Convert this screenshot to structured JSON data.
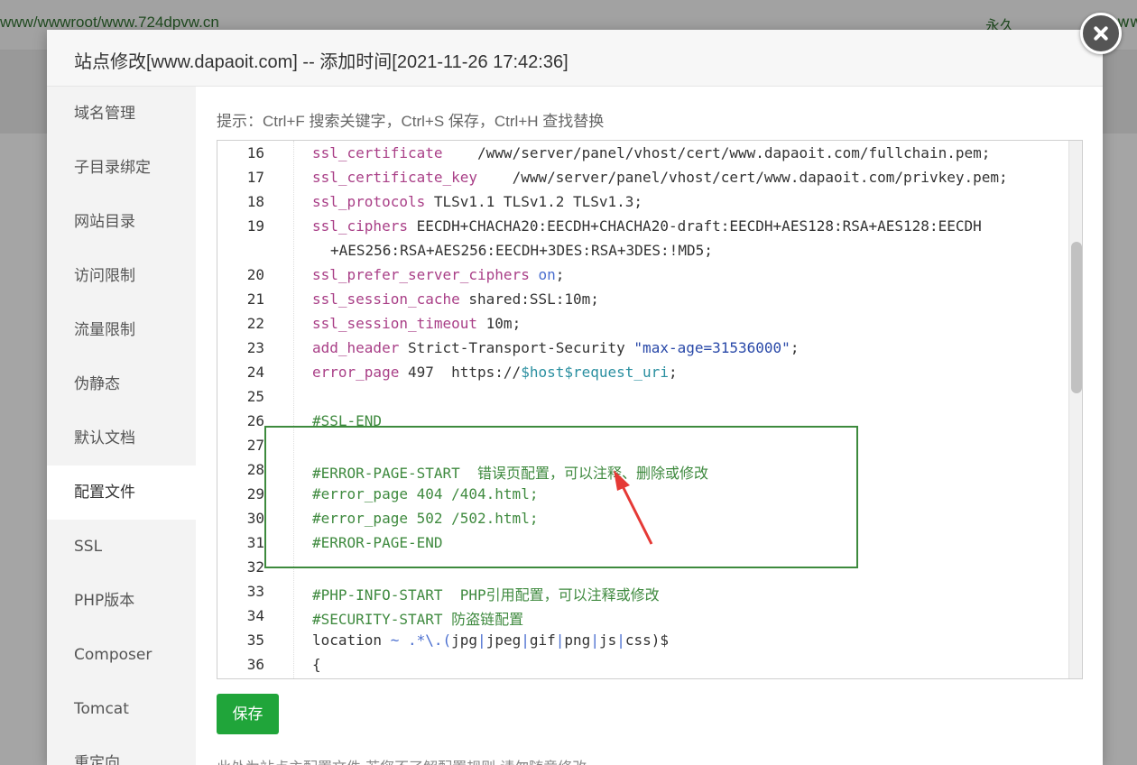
{
  "background": {
    "site_path": "www/wwwroot/www.724dpvw.cn",
    "expire_label": "永久",
    "right_fragment": "ww"
  },
  "modal": {
    "title": "站点修改[www.dapaoit.com] -- 添加时间[2021-11-26 17:42:36]",
    "close_icon": "close-icon"
  },
  "sidebar": {
    "items": [
      {
        "label": "域名管理"
      },
      {
        "label": "子目录绑定"
      },
      {
        "label": "网站目录"
      },
      {
        "label": "访问限制"
      },
      {
        "label": "流量限制"
      },
      {
        "label": "伪静态"
      },
      {
        "label": "默认文档"
      },
      {
        "label": "配置文件",
        "active": true
      },
      {
        "label": "SSL"
      },
      {
        "label": "PHP版本"
      },
      {
        "label": "Composer"
      },
      {
        "label": "Tomcat"
      },
      {
        "label": "重定向"
      }
    ]
  },
  "editor": {
    "hint": "提示：Ctrl+F 搜索关键字，Ctrl+S 保存，Ctrl+H 查找替换",
    "line_numbers": [
      "16",
      "17",
      "18",
      "19",
      "20",
      "21",
      "22",
      "23",
      "24",
      "25",
      "26",
      "27",
      "28",
      "29",
      "30",
      "31",
      "32",
      "33",
      "34",
      "35",
      "36"
    ],
    "lines": {
      "l16": {
        "k": "ssl_certificate",
        "v": "    /www/server/panel/vhost/cert/www.dapaoit.com/fullchain.pem;"
      },
      "l17": {
        "k": "ssl_certificate_key",
        "v": "    /www/server/panel/vhost/cert/www.dapaoit.com/privkey.pem;"
      },
      "l18": {
        "k": "ssl_protocols",
        "v": " TLSv1.1 TLSv1.2 TLSv1.3;"
      },
      "l19": {
        "k": "ssl_ciphers",
        "v": " EECDH+CHACHA20:EECDH+CHACHA20-draft:EECDH+AES128:RSA+AES128:EECDH"
      },
      "l19b": {
        "v": "+AES256:RSA+AES256:EECDH+3DES:RSA+3DES:!MD5;"
      },
      "l20": {
        "k": "ssl_prefer_server_ciphers",
        "on": " on",
        "v": ";"
      },
      "l21": {
        "k": "ssl_session_cache",
        "v": " shared:SSL:10m;"
      },
      "l22": {
        "k": "ssl_session_timeout",
        "v": " 10m;"
      },
      "l23": {
        "k": "add_header",
        "v": " Strict-Transport-Security ",
        "str": "\"max-age=31536000\"",
        "v2": ";"
      },
      "l24": {
        "k": "error_page",
        "v": " 497  https://",
        "var": "$host$request_uri",
        "v2": ";"
      },
      "l26": {
        "cmt": "#SSL-END"
      },
      "l28": {
        "cmt": "#ERROR-PAGE-START  错误页配置，可以注释、删除或修改"
      },
      "l29": {
        "cmt": "#error_page 404 /404.html;"
      },
      "l30": {
        "cmt": "#error_page 502 /502.html;"
      },
      "l31": {
        "cmt": "#ERROR-PAGE-END"
      },
      "l33": {
        "cmt": "#PHP-INFO-START  PHP引用配置，可以注释或修改"
      },
      "l34": {
        "cmt": "#SECURITY-START 防盗链配置"
      },
      "l35": {
        "v": "location ",
        "op": "~ .*\\.(",
        "v2": "jpg",
        "op2": "|",
        "v3": "jpeg",
        "op3": "|",
        "v4": "gif",
        "op4": "|",
        "v5": "png",
        "op5": "|",
        "v6": "js",
        "op6": "|",
        "v7": "css",
        "op7": ")",
        "v8": "$"
      },
      "l36": {
        "v": "{"
      }
    }
  },
  "actions": {
    "save_label": "保存",
    "footnote": "此处为站点主配置文件,若您不了解配置规则,请勿随意修改."
  },
  "colors": {
    "save_button": "#20a53a",
    "highlight_box": "#3d8a3d",
    "annotation_arrow": "#e53935"
  }
}
